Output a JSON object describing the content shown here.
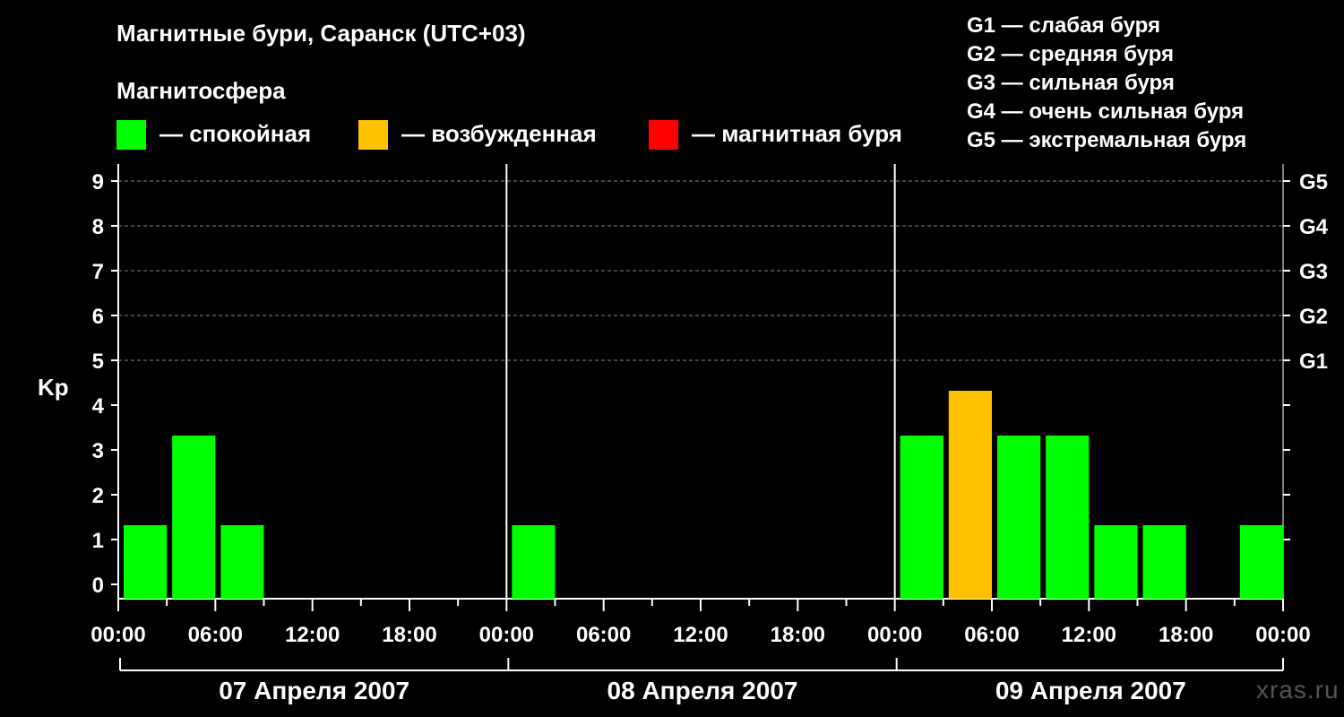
{
  "title": "Магнитные бури, Саранск (UTC+03)",
  "legend": {
    "title": "Магнитосфера",
    "items": [
      {
        "label": "— спокойная",
        "color": "#00ff00"
      },
      {
        "label": "— возбужденная",
        "color": "#ffc000"
      },
      {
        "label": "— магнитная буря",
        "color": "#ff0000"
      }
    ]
  },
  "g_scale": [
    {
      "label": "G1 — слабая буря"
    },
    {
      "label": "G2 — средняя буря"
    },
    {
      "label": "G3 — сильная буря"
    },
    {
      "label": "G4 — очень сильная буря"
    },
    {
      "label": "G5 — экстремальная буря"
    }
  ],
  "watermark": "xras.ru",
  "chart_data": {
    "type": "bar",
    "ylabel": "Kp",
    "ylim": [
      0,
      9
    ],
    "yticks": [
      "0",
      "1",
      "2",
      "3",
      "4",
      "5",
      "6",
      "7",
      "8",
      "9"
    ],
    "right_ticks": [
      {
        "kp": 5,
        "label": "G1"
      },
      {
        "kp": 6,
        "label": "G2"
      },
      {
        "kp": 7,
        "label": "G3"
      },
      {
        "kp": 8,
        "label": "G4"
      },
      {
        "kp": 9,
        "label": "G5"
      }
    ],
    "grid": "dashed horizontal at Kp 5–9",
    "x_tick_labels": [
      "00:00",
      "06:00",
      "12:00",
      "18:00",
      "00:00",
      "06:00",
      "12:00",
      "18:00",
      "00:00",
      "06:00",
      "12:00",
      "18:00",
      "00:00"
    ],
    "days": [
      "07 Апреля 2007",
      "08 Апреля 2007",
      "09 Апреля 2007"
    ],
    "interval_hours": 3,
    "colors": {
      "quiet": "#00ff00",
      "active": "#ffc000",
      "storm": "#ff0000"
    },
    "values": [
      [
        1,
        3,
        1,
        0,
        0,
        0,
        0,
        0
      ],
      [
        1,
        0,
        0,
        0,
        0,
        0,
        0,
        0
      ],
      [
        3,
        4,
        3,
        3,
        1,
        1,
        0,
        1
      ]
    ]
  }
}
